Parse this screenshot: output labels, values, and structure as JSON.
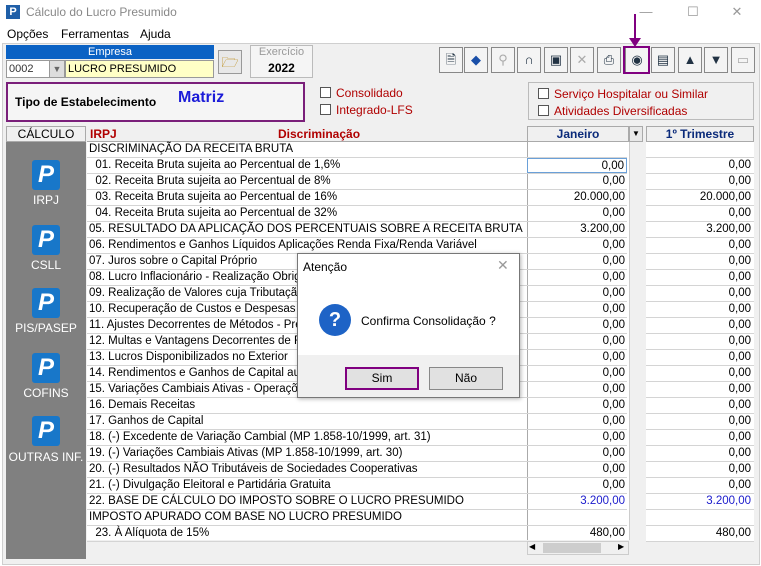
{
  "window": {
    "title": "Cálculo do Lucro Presumido",
    "app_icon": "P"
  },
  "menu": [
    "Opções",
    "Ferramentas",
    "Ajuda"
  ],
  "empresa": {
    "header": "Empresa",
    "code": "0002",
    "name": "LUCRO PRESUMIDO"
  },
  "exercicio": {
    "label": "Exercício",
    "value": "2022"
  },
  "tipo": {
    "label": "Tipo de Estabelecimento",
    "value": "Matriz"
  },
  "options": {
    "consolidado": "Consolidado",
    "integrado": "Integrado-LFS",
    "servico": "Serviço Hospitalar ou Similar",
    "atividades": "Atividades Diversificadas"
  },
  "side": {
    "header": "CÁLCULO",
    "icon_letter": "P",
    "items": [
      "IRPJ",
      "CSLL",
      "PIS/PASEP",
      "COFINS",
      "OUTRAS INF."
    ]
  },
  "grid": {
    "col_irpj": "IRPJ",
    "col_disc": "Discriminação",
    "col_jan": "Janeiro",
    "col_tri": "1º Trimestre",
    "rows": [
      {
        "label": "DISCRIMINAÇÃO DA RECEITA BRUTA",
        "jan": "",
        "tri": ""
      },
      {
        "label": "  01. Receita Bruta sujeita ao Percentual de 1,6%",
        "jan": "0,00",
        "tri": "0,00"
      },
      {
        "label": "  02. Receita Bruta sujeita ao Percentual de 8%",
        "jan": "0,00",
        "tri": "0,00"
      },
      {
        "label": "  03. Receita Bruta sujeita ao Percentual de 16%",
        "jan": "20.000,00",
        "tri": "20.000,00"
      },
      {
        "label": "  04. Receita Bruta sujeita ao Percentual de 32%",
        "jan": "0,00",
        "tri": "0,00"
      },
      {
        "label": "05. RESULTADO DA APLICAÇÃO DOS PERCENTUAIS SOBRE A RECEITA BRUTA",
        "jan": "3.200,00",
        "tri": "3.200,00"
      },
      {
        "label": "06. Rendimentos e Ganhos Líquidos Aplicações Renda Fixa/Renda Variável",
        "jan": "0,00",
        "tri": "0,00"
      },
      {
        "label": "07. Juros sobre o Capital Próprio",
        "jan": "0,00",
        "tri": "0,00"
      },
      {
        "label": "08. Lucro Inflacionário - Realização Obrigat",
        "jan": "0,00",
        "tri": "0,00"
      },
      {
        "label": "09. Realização de Valores cuja Tributação t",
        "jan": "0,00",
        "tri": "0,00"
      },
      {
        "label": "10. Recuperação de Custos e Despesas",
        "jan": "0,00",
        "tri": "0,00"
      },
      {
        "label": "11. Ajustes Decorrentes de Métodos - Preç",
        "jan": "0,00",
        "tri": "0,00"
      },
      {
        "label": "12. Multas e Vantagens Decorrentes de Res",
        "jan": "0,00",
        "tri": "0,00"
      },
      {
        "label": "13. Lucros Disponibilizados no Exterior",
        "jan": "0,00",
        "tri": "0,00"
      },
      {
        "label": "14. Rendimentos e Ganhos de Capital aufer",
        "jan": "0,00",
        "tri": "0,00"
      },
      {
        "label": "15. Variações Cambiais Ativas - Operações",
        "jan": "0,00",
        "tri": "0,00"
      },
      {
        "label": "16. Demais Receitas",
        "jan": "0,00",
        "tri": "0,00"
      },
      {
        "label": "17. Ganhos de Capital",
        "jan": "0,00",
        "tri": "0,00"
      },
      {
        "label": "18. (-) Excedente de Variação Cambial (MP 1.858-10/1999, art. 31)",
        "jan": "0,00",
        "tri": "0,00"
      },
      {
        "label": "19. (-) Variações Cambiais Ativas (MP 1.858-10/1999, art. 30)",
        "jan": "0,00",
        "tri": "0,00"
      },
      {
        "label": "20. (-) Resultados NÃO Tributáveis de Sociedades Cooperativas",
        "jan": "0,00",
        "tri": "0,00"
      },
      {
        "label": "21. (-) Divulgação Eleitoral e Partidária Gratuita",
        "jan": "0,00",
        "tri": "0,00"
      },
      {
        "label": "22. BASE DE CÁLCULO DO IMPOSTO SOBRE O LUCRO PRESUMIDO",
        "jan": "3.200,00",
        "tri": "3.200,00"
      },
      {
        "label": "IMPOSTO APURADO COM BASE NO LUCRO PRESUMIDO",
        "jan": "",
        "tri": ""
      },
      {
        "label": "  23. À Alíquota de 15%",
        "jan": "480,00",
        "tri": "480,00"
      }
    ]
  },
  "dialog": {
    "title": "Atenção",
    "message": "Confirma Consolidação ?",
    "yes": "Sim",
    "no": "Não"
  },
  "colors": {
    "accent": "#800080",
    "blue_value": "#1a1acc",
    "header_red": "#b00000"
  }
}
